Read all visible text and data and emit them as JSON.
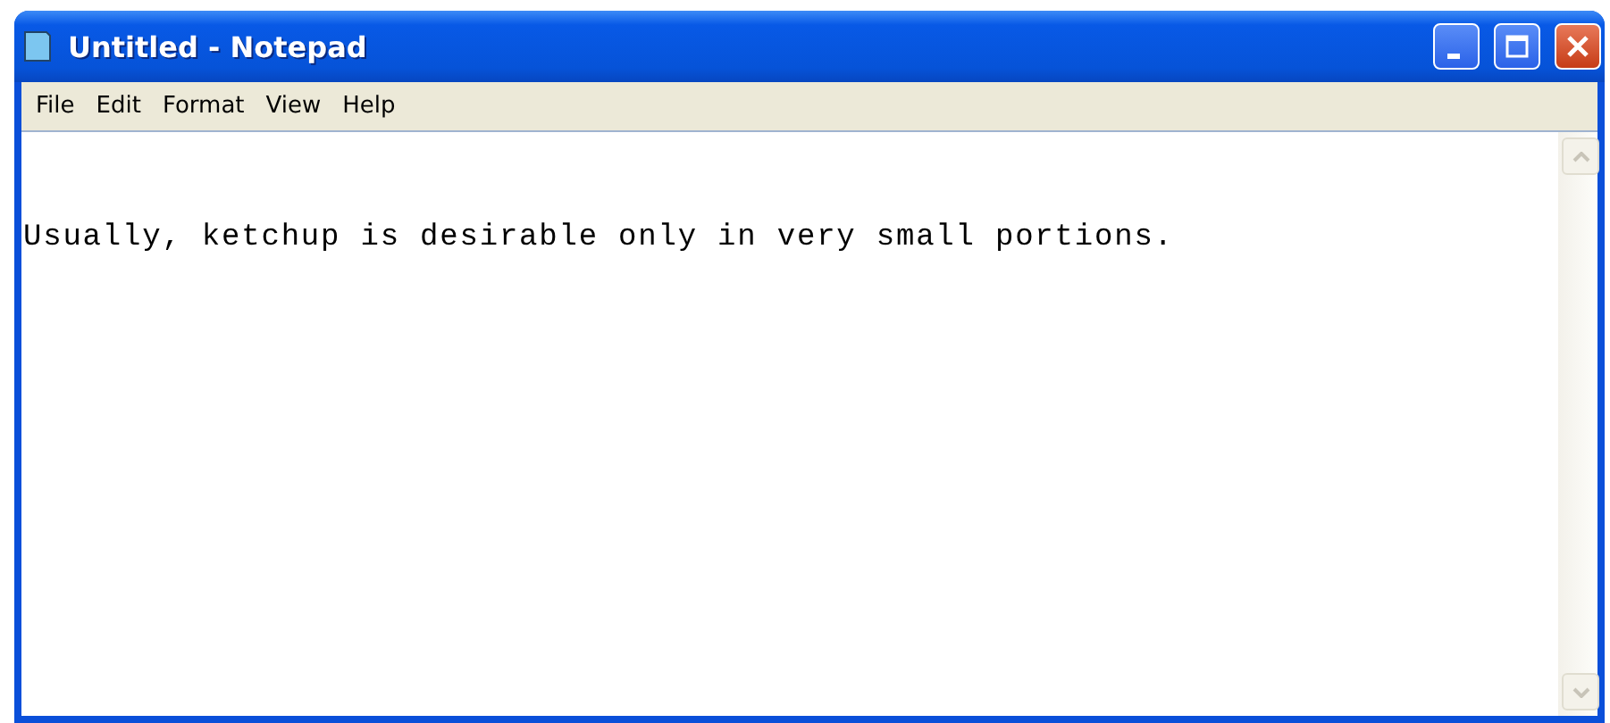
{
  "window": {
    "title": "Untitled - Notepad"
  },
  "menu": [
    "File",
    "Edit",
    "Format",
    "View",
    "Help"
  ],
  "editor": {
    "text": "Usually, ketchup is desirable only in very small portions."
  }
}
